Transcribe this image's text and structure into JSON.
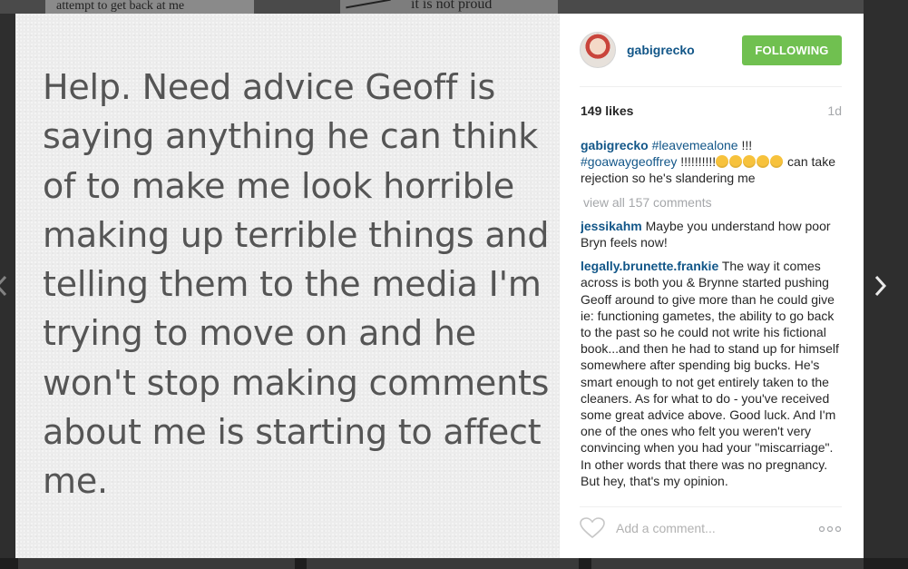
{
  "backdrop": {
    "snippet_left": "attempt to get back at me",
    "snippet_right": "it is not proud"
  },
  "post": {
    "image_text": "Help. Need advice Geoff is saying anything he can think of to make me look horrible making up terrible things and telling them to the media I'm trying to move on and he won't stop making comments about me is starting to affect me."
  },
  "header": {
    "username": "gabigrecko",
    "follow_label": "FOLLOWING"
  },
  "stats": {
    "likes": "149 likes",
    "age": "1d"
  },
  "caption": {
    "user": "gabigrecko",
    "tag1": "#leavemealone",
    "text1": " !!! ",
    "tag2": "#goawaygeoffrey",
    "text2": " !!!!!!!!!!",
    "text3": " can take rejection so he's slandering me"
  },
  "view_all": "view all 157 comments",
  "comments": [
    {
      "user": "jessikahm",
      "text": " Maybe you understand how poor Bryn feels now!"
    },
    {
      "user": "legally.brunette.frankie",
      "text": " The way it comes across is both you & Brynne started pushing Geoff around to give more than he could give ie: functioning gametes, the ability to go back to the past so he could not write his fictional book...and then he had to stand up for himself somewhere after spending big bucks. He's smart enough to not get entirely taken to the cleaners. As for what to do - you've received some great advice above. Good luck. And I'm one of the ones who felt you weren't very convincing when you had your \"miscarriage\". In other words that there was no pregnancy. But hey, that's my opinion."
    }
  ],
  "footer": {
    "comment_placeholder": "Add a comment...",
    "more": "ooo"
  },
  "colors": {
    "link_blue": "#125688",
    "follow_green": "#70c050",
    "muted_gray": "#a5a7aa"
  },
  "icons": {
    "like": "heart-icon",
    "more": "more-options-icon",
    "nav_prev": "chevron-left-icon",
    "nav_next": "chevron-right-icon"
  }
}
